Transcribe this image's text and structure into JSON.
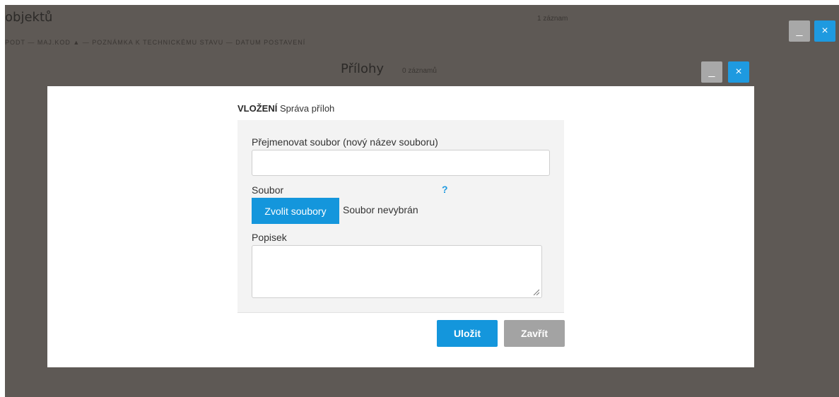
{
  "background_window": {
    "title": "objektů",
    "record_count": "1 záznam",
    "table_header_partial": "PODT — MAJ.KOD ▲ — POZNÁMKA K TECHNICKÉMU STAVU — DATUM POSTAVENÍ"
  },
  "dialog": {
    "title": "Přílohy",
    "record_count": "0 záznamů",
    "minimize_label": "_",
    "close_label": "×"
  },
  "outer_controls": {
    "minimize_label": "_",
    "close_label": "×"
  },
  "form": {
    "heading_bold": "VLOŽENÍ",
    "heading_rest": "Správa příloh",
    "rename_label": "Přejmenovat soubor (nový název souboru)",
    "rename_value": "",
    "file_label": "Soubor",
    "help_label": "?",
    "choose_files_label": "Zvolit soubory",
    "file_status": "Soubor nevybrán",
    "description_label": "Popisek",
    "description_value": "",
    "save_label": "Uložit",
    "close_label": "Zavřít"
  },
  "colors": {
    "accent": "#1496dc",
    "overlay": "#5e5955",
    "secondary_button": "#a3a3a3"
  }
}
